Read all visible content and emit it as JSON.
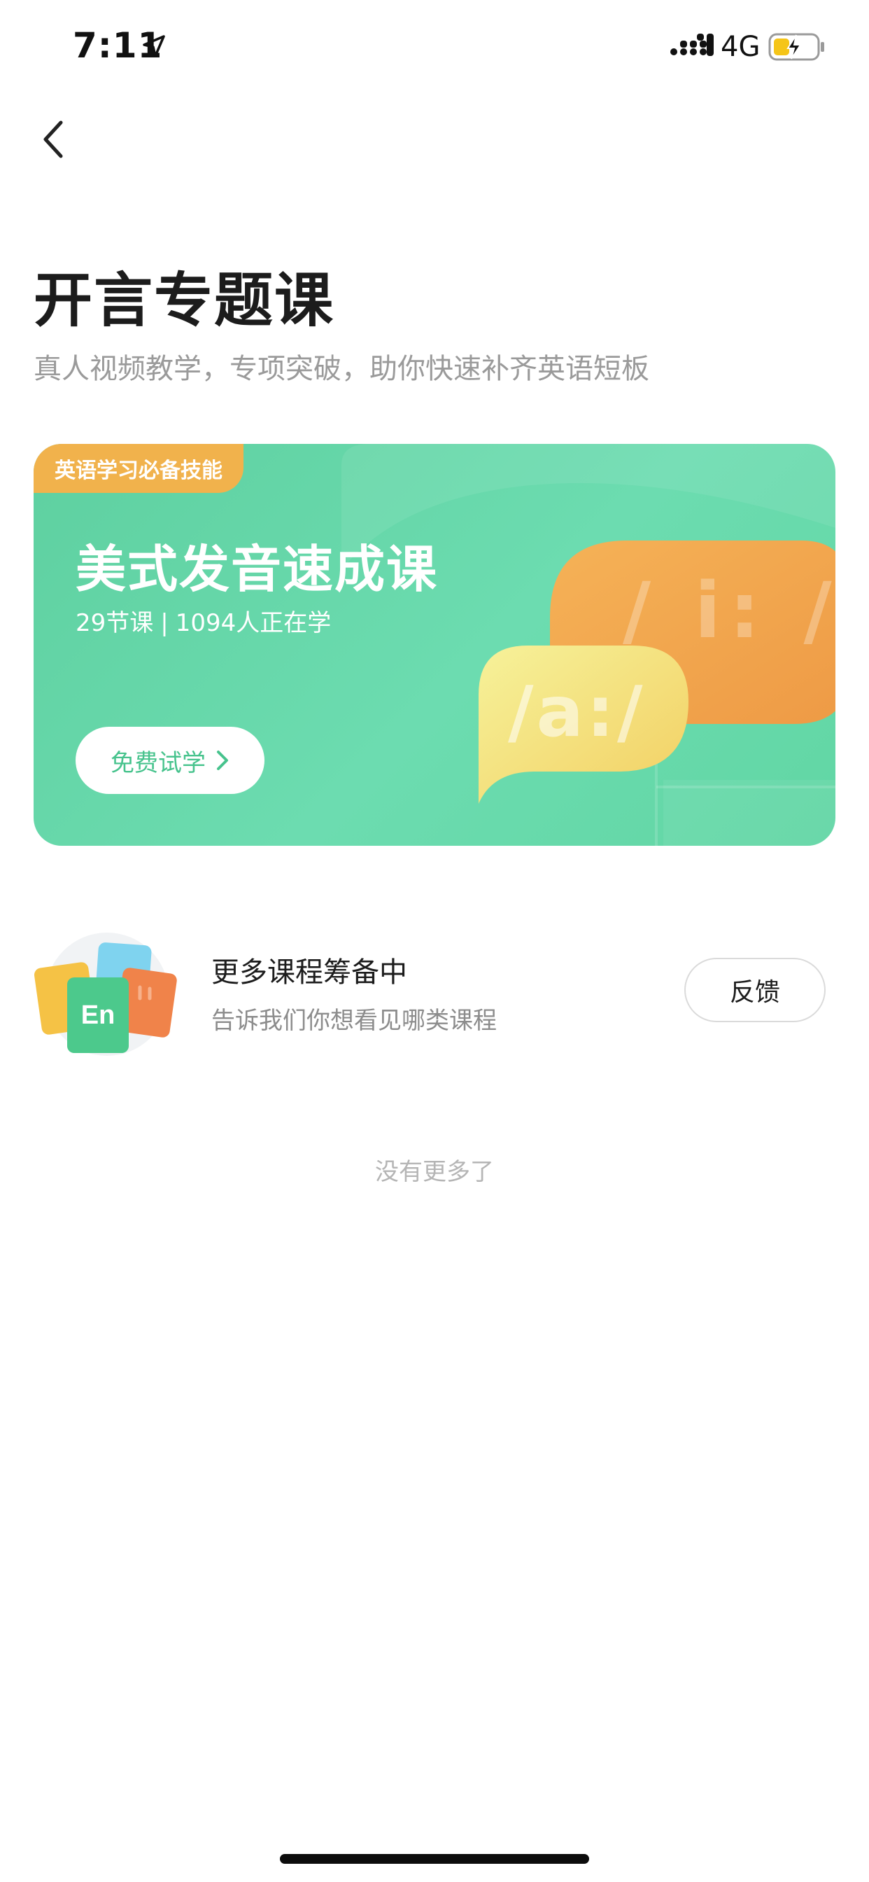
{
  "status_bar": {
    "time": "7:11",
    "network": "4G",
    "icons": [
      "location-arrow-icon",
      "signal-icon",
      "battery-charging-icon"
    ]
  },
  "header": {
    "back_icon": "chevron-left-icon",
    "title": "开言专题课",
    "subtitle": "真人视频教学，专项突破，助你快速补齐英语短板"
  },
  "course_card": {
    "tag": "英语学习必备技能",
    "title": "美式发音速成课",
    "lessons": "29节课",
    "separator": "|",
    "learners": "1094人正在学",
    "button_label": "免费试学",
    "bubble_back_text": "/ i: /",
    "bubble_front_text": "/a:/",
    "colors": {
      "card": "#61d6a4",
      "tag": "#f1b24c",
      "button_text": "#47c38d",
      "bubble_orange": "#f2a24e",
      "bubble_yellow": "#f4e07a"
    }
  },
  "more_courses": {
    "title": "更多课程筹备中",
    "subtitle": "告诉我们你想看见哪类课程",
    "illustration_text": "En",
    "feedback_label": "反馈"
  },
  "footer": {
    "end_text": "没有更多了"
  }
}
